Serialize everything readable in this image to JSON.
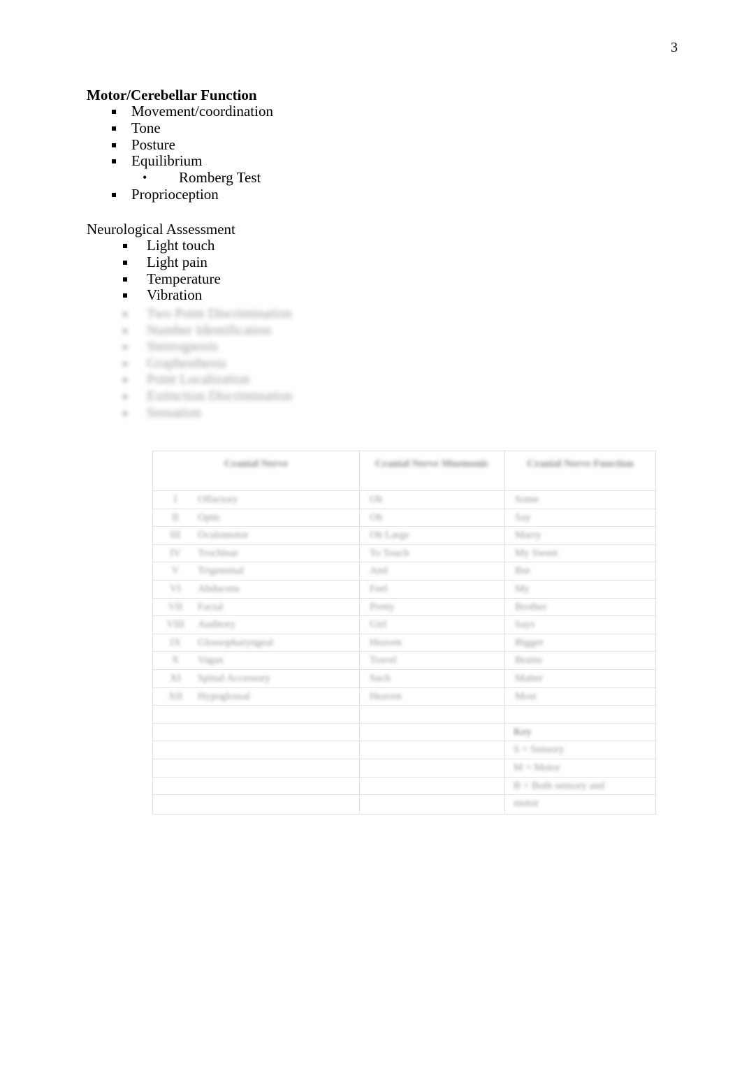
{
  "page": {
    "number": "3"
  },
  "sections": [
    {
      "id": "motor-cerebellar",
      "heading": "Motor/Cerebellar Function",
      "bold": true,
      "items": [
        {
          "label": "Movement/coordination",
          "bullet": "square"
        },
        {
          "label": "Tone",
          "bullet": "square"
        },
        {
          "label": "Posture",
          "bullet": "square"
        },
        {
          "label": "Equilibrium",
          "bullet": "square"
        },
        {
          "label": "Romberg Test",
          "bullet": "round"
        },
        {
          "label": "Proprioception",
          "bullet": "square"
        }
      ]
    },
    {
      "id": "neurological-assessment",
      "heading": "Neurological Assessment",
      "bold": false,
      "items": [
        {
          "label": "Light touch",
          "bullet": "square"
        },
        {
          "label": "Light pain",
          "bullet": "square"
        },
        {
          "label": "Temperature",
          "bullet": "square"
        },
        {
          "label": "Vibration",
          "bullet": "square"
        }
      ],
      "obscured_items": [
        {
          "label": "Two Point Discrimination",
          "obscured": true
        },
        {
          "label": "Number Identification",
          "obscured": true
        },
        {
          "label": "Stereognosis",
          "obscured": true
        },
        {
          "label": "Graphesthesia",
          "obscured": true
        },
        {
          "label": "Point Localization",
          "obscured": true
        },
        {
          "label": "Extinction Discrimination",
          "obscured": true
        },
        {
          "label": "Sensation",
          "obscured": true
        }
      ]
    }
  ],
  "table": {
    "id": "cranial-nerve-table",
    "obscured": true,
    "headers": [
      "Cranial Nerve",
      "Cranial Nerve Mnemonic",
      "Cranial Nerve Function"
    ],
    "rows": [
      {
        "numeral": "I",
        "nerve": "Olfactory",
        "mnemonic": "Oh",
        "function": "Some"
      },
      {
        "numeral": "II",
        "nerve": "Optic",
        "mnemonic": "Oh",
        "function": "Say"
      },
      {
        "numeral": "III",
        "nerve": "Oculomotor",
        "mnemonic": "Oh Large",
        "function": "Marry"
      },
      {
        "numeral": "IV",
        "nerve": "Trochlear",
        "mnemonic": "To Touch",
        "function": "My Sweet"
      },
      {
        "numeral": "V",
        "nerve": "Trigeminal",
        "mnemonic": "And",
        "function": "But"
      },
      {
        "numeral": "VI",
        "nerve": "Abducens",
        "mnemonic": "Feel",
        "function": "My"
      },
      {
        "numeral": "VII",
        "nerve": "Facial",
        "mnemonic": "Pretty",
        "function": "Brother"
      },
      {
        "numeral": "VIII",
        "nerve": "Auditory",
        "mnemonic": "Girl",
        "function": "Says"
      },
      {
        "numeral": "IX",
        "nerve": "Glossopharyngeal",
        "mnemonic": "Heaven",
        "function": "Bigger"
      },
      {
        "numeral": "X",
        "nerve": "Vagus",
        "mnemonic": "Travel",
        "function": "Brains"
      },
      {
        "numeral": "XI",
        "nerve": "Spinal Accessory",
        "mnemonic": "Such",
        "function": "Matter"
      },
      {
        "numeral": "XII",
        "nerve": "Hypoglossal",
        "mnemonic": "Heaven",
        "function": "Most"
      }
    ],
    "empty_rows": 5,
    "legend": {
      "title": "Key",
      "entries": [
        "S = Sensory",
        "M = Motor",
        "B = Both sensory and",
        "motor"
      ]
    }
  }
}
